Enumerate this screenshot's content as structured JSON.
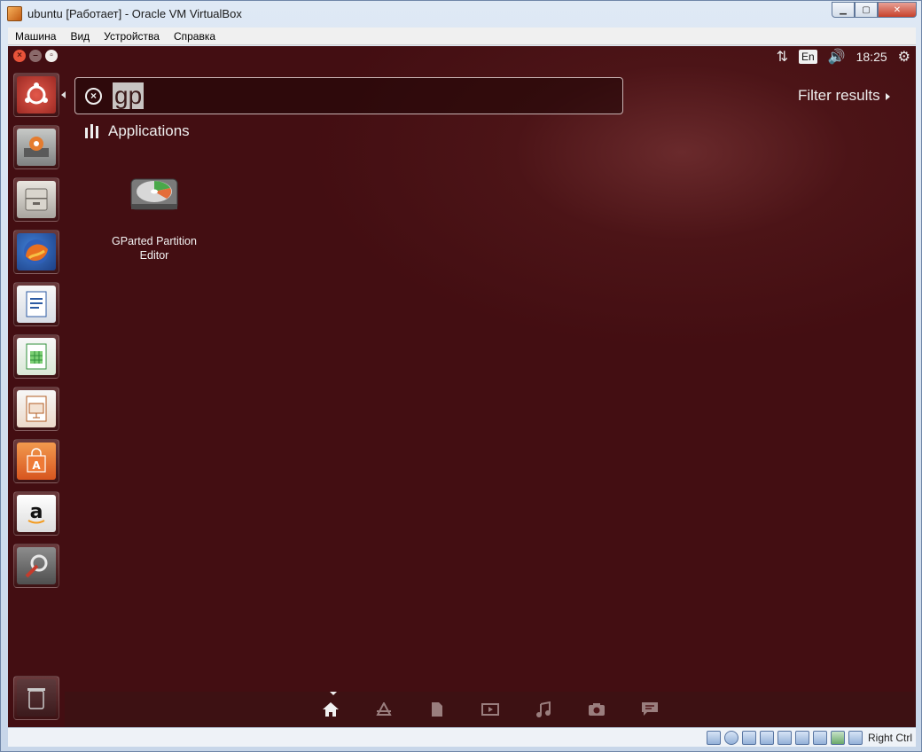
{
  "window": {
    "title": "ubuntu [Работает] - Oracle VM VirtualBox",
    "minimize_glyph": "▁",
    "maximize_glyph": "▢",
    "close_glyph": "✕"
  },
  "menu": {
    "items": [
      "Машина",
      "Вид",
      "Устройства",
      "Справка"
    ]
  },
  "guest_panel": {
    "keyboard_layout": "En",
    "clock": "18:25"
  },
  "launcher": {
    "items": [
      {
        "name": "ubuntu-dash",
        "icon": "dash-home-icon"
      },
      {
        "name": "software-updater",
        "icon": "software-updater-icon"
      },
      {
        "name": "files",
        "icon": "file-cabinet-icon"
      },
      {
        "name": "firefox",
        "icon": "firefox-icon"
      },
      {
        "name": "libreoffice-writer",
        "icon": "writer-document-icon"
      },
      {
        "name": "libreoffice-calc",
        "icon": "calc-spreadsheet-icon"
      },
      {
        "name": "libreoffice-impress",
        "icon": "impress-presentation-icon"
      },
      {
        "name": "ubuntu-software-center",
        "icon": "shopping-bag-icon"
      },
      {
        "name": "amazon",
        "icon": "amazon-icon"
      },
      {
        "name": "system-settings",
        "icon": "wrench-gear-icon"
      },
      {
        "name": "trash",
        "icon": "trash-icon"
      }
    ]
  },
  "dash": {
    "search_query": "gp",
    "filter_label": "Filter results",
    "category_title": "Applications",
    "results": [
      {
        "label": "GParted Partition Editor",
        "icon": "gparted-disk-icon"
      }
    ],
    "lenses": [
      "home-icon",
      "applications-icon",
      "files-icon",
      "video-icon",
      "music-icon",
      "photo-icon",
      "social-icon"
    ]
  },
  "statusbar": {
    "host_key": "Right Ctrl"
  },
  "colors": {
    "dash_background": "#430e12",
    "accent": "#e8533a"
  }
}
